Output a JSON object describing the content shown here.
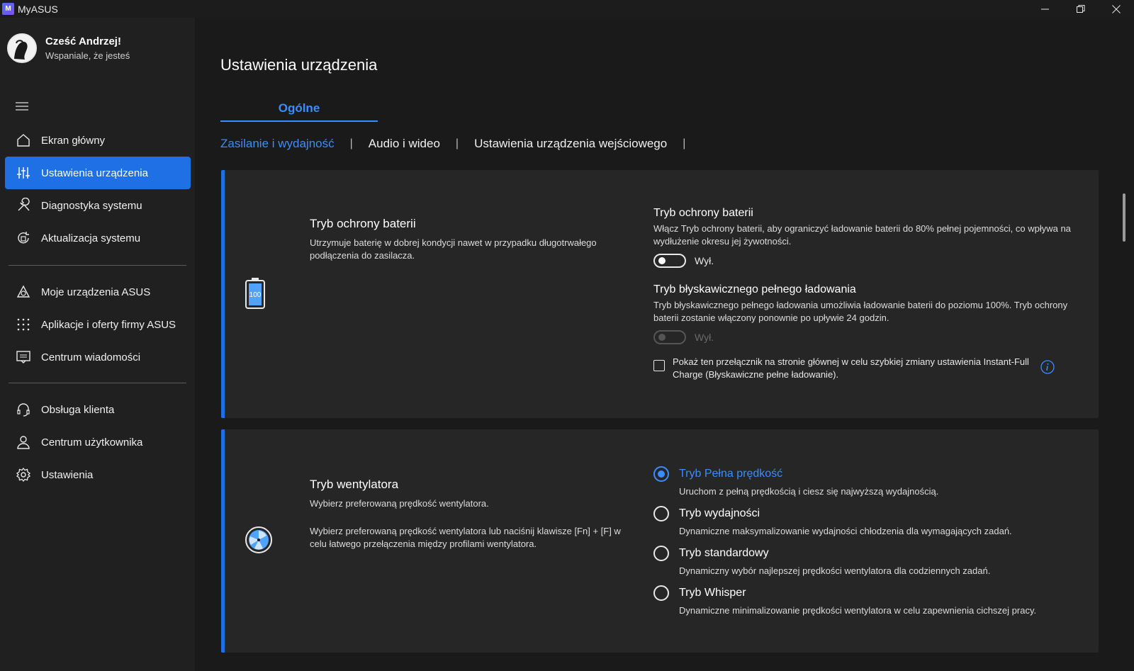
{
  "window": {
    "title": "MyASUS",
    "logo_text": "M"
  },
  "profile": {
    "greeting": "Cześć Andrzej!",
    "subtitle": "Wspaniale, że jesteś"
  },
  "sidebar": {
    "groups": [
      [
        {
          "label": "Ekran główny",
          "icon": "home-icon"
        },
        {
          "label": "Ustawienia urządzenia",
          "icon": "sliders-icon",
          "active": true
        },
        {
          "label": "Diagnostyka systemu",
          "icon": "wrench-icon"
        },
        {
          "label": "Aktualizacja systemu",
          "icon": "update-icon"
        }
      ],
      [
        {
          "label": "Moje urządzenia ASUS",
          "icon": "devices-icon"
        },
        {
          "label": "Aplikacje i oferty firmy ASUS",
          "icon": "apps-grid-icon"
        },
        {
          "label": "Centrum wiadomości",
          "icon": "message-icon"
        }
      ],
      [
        {
          "label": "Obsługa klienta",
          "icon": "headset-icon"
        },
        {
          "label": "Centrum użytkownika",
          "icon": "user-icon"
        },
        {
          "label": "Ustawienia",
          "icon": "gear-icon"
        }
      ]
    ]
  },
  "main": {
    "title": "Ustawienia urządzenia",
    "tab": "Ogólne",
    "subtabs": [
      "Zasilanie i wydajność",
      "Audio i wideo",
      "Ustawienia urządzenia wejściowego"
    ],
    "active_subtab": 0
  },
  "battery_card": {
    "icon_text": "100",
    "title": "Tryb ochrony baterii",
    "description": "Utrzymuje baterię w dobrej kondycji nawet w przypadku długotrwałego podłączenia do zasilacza.",
    "protection": {
      "title": "Tryb ochrony baterii",
      "description": "Włącz Tryb ochrony baterii, aby ograniczyć ładowanie baterii do 80% pełnej pojemności, co wpływa na wydłużenie okresu jej żywotności.",
      "toggle_label": "Wył.",
      "enabled": false
    },
    "instant_full": {
      "title": "Tryb błyskawicznego pełnego ładowania",
      "description": "Tryb błyskawicznego pełnego ładowania umożliwia ładowanie baterii do poziomu 100%. Tryb ochrony baterii zostanie włączony ponownie po upływie 24 godzin.",
      "toggle_label": "Wył.",
      "enabled": false,
      "disabled": true
    },
    "checkbox_label": "Pokaż ten przełącznik na stronie głównej w celu szybkiej zmiany ustawienia Instant-Full Charge (Błyskawiczne pełne ładowanie).",
    "checkbox_checked": false
  },
  "fan_card": {
    "title": "Tryb wentylatora",
    "description": "Wybierz preferowaną prędkość wentylatora.",
    "description2": "Wybierz preferowaną prędkość wentylatora lub naciśnij klawisze [Fn] + [F] w celu łatwego przełączenia między profilami wentylatora.",
    "options": [
      {
        "label": "Tryb Pełna prędkość",
        "desc": "Uruchom z pełną prędkością i ciesz się najwyższą wydajnością.",
        "selected": true
      },
      {
        "label": "Tryb wydajności",
        "desc": "Dynamiczne maksymalizowanie wydajności chłodzenia dla wymagających zadań."
      },
      {
        "label": "Tryb standardowy",
        "desc": "Dynamiczny wybór najlepszej prędkości wentylatora dla codziennych zadań."
      },
      {
        "label": "Tryb Whisper",
        "desc": "Dynamiczne minimalizowanie prędkości wentylatora w celu zapewnienia cichszej pracy."
      }
    ]
  },
  "colors": {
    "accent": "#1f6fe5",
    "accent_text": "#3b8cff",
    "sidebar_bg": "#202020",
    "card_bg": "#262626"
  }
}
